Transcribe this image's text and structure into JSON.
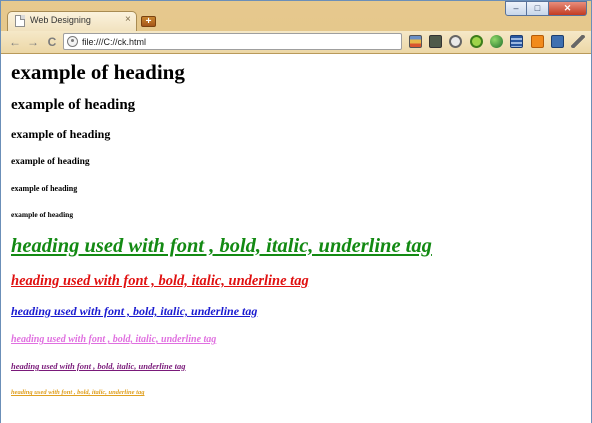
{
  "browser": {
    "tab_title": "Web Designing",
    "tab_close_glyph": "×",
    "new_tab_glyph": "+",
    "url": "file:///C://ck.html",
    "window_buttons": {
      "minimize": "–",
      "maximize": "□",
      "close": "✕"
    },
    "nav": {
      "back": "←",
      "forward": "→",
      "reload": "C"
    },
    "extensions": [
      "bookmarks-icon",
      "k-extension-icon",
      "feed-icon",
      "alarm-icon",
      "globe-icon",
      "menu-lines-icon",
      "blogger-icon",
      "camera-icon",
      "wrench-icon"
    ]
  },
  "headings": [
    "example of heading",
    "example of heading",
    "example of heading",
    "example of heading",
    "example of heading",
    "example of heading"
  ],
  "font_lines": [
    {
      "text": "heading used with font , bold, italic, underline tag",
      "color": "#138a13"
    },
    {
      "text": "heading used with font , bold, italic, underline tag",
      "color": "#e01010"
    },
    {
      "text": "heading used with font , bold, italic, underline tag",
      "color": "#1a1ad0"
    },
    {
      "text": "heading used with font , bold, italic, underline tag",
      "color": "#e070e0"
    },
    {
      "text": "heading used with font , bold, italic, underline tag",
      "color": "#7a1a7a"
    },
    {
      "text": "heading used with font , bold, italic, underline tag",
      "color": "#e0a020"
    }
  ]
}
